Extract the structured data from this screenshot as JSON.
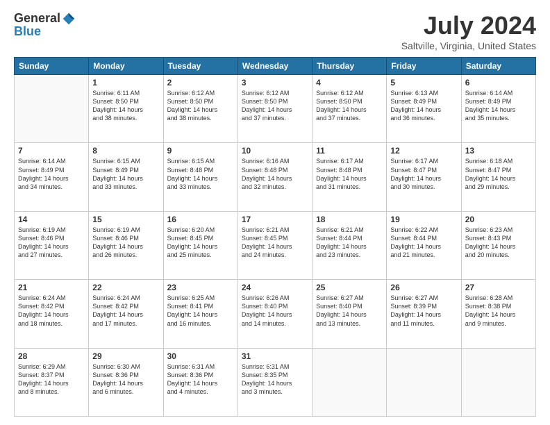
{
  "header": {
    "logo_general": "General",
    "logo_blue": "Blue",
    "month_title": "July 2024",
    "location": "Saltville, Virginia, United States"
  },
  "days_of_week": [
    "Sunday",
    "Monday",
    "Tuesday",
    "Wednesday",
    "Thursday",
    "Friday",
    "Saturday"
  ],
  "weeks": [
    [
      {
        "day": "",
        "info": ""
      },
      {
        "day": "1",
        "info": "Sunrise: 6:11 AM\nSunset: 8:50 PM\nDaylight: 14 hours\nand 38 minutes."
      },
      {
        "day": "2",
        "info": "Sunrise: 6:12 AM\nSunset: 8:50 PM\nDaylight: 14 hours\nand 38 minutes."
      },
      {
        "day": "3",
        "info": "Sunrise: 6:12 AM\nSunset: 8:50 PM\nDaylight: 14 hours\nand 37 minutes."
      },
      {
        "day": "4",
        "info": "Sunrise: 6:12 AM\nSunset: 8:50 PM\nDaylight: 14 hours\nand 37 minutes."
      },
      {
        "day": "5",
        "info": "Sunrise: 6:13 AM\nSunset: 8:49 PM\nDaylight: 14 hours\nand 36 minutes."
      },
      {
        "day": "6",
        "info": "Sunrise: 6:14 AM\nSunset: 8:49 PM\nDaylight: 14 hours\nand 35 minutes."
      }
    ],
    [
      {
        "day": "7",
        "info": "Sunrise: 6:14 AM\nSunset: 8:49 PM\nDaylight: 14 hours\nand 34 minutes."
      },
      {
        "day": "8",
        "info": "Sunrise: 6:15 AM\nSunset: 8:49 PM\nDaylight: 14 hours\nand 33 minutes."
      },
      {
        "day": "9",
        "info": "Sunrise: 6:15 AM\nSunset: 8:48 PM\nDaylight: 14 hours\nand 33 minutes."
      },
      {
        "day": "10",
        "info": "Sunrise: 6:16 AM\nSunset: 8:48 PM\nDaylight: 14 hours\nand 32 minutes."
      },
      {
        "day": "11",
        "info": "Sunrise: 6:17 AM\nSunset: 8:48 PM\nDaylight: 14 hours\nand 31 minutes."
      },
      {
        "day": "12",
        "info": "Sunrise: 6:17 AM\nSunset: 8:47 PM\nDaylight: 14 hours\nand 30 minutes."
      },
      {
        "day": "13",
        "info": "Sunrise: 6:18 AM\nSunset: 8:47 PM\nDaylight: 14 hours\nand 29 minutes."
      }
    ],
    [
      {
        "day": "14",
        "info": "Sunrise: 6:19 AM\nSunset: 8:46 PM\nDaylight: 14 hours\nand 27 minutes."
      },
      {
        "day": "15",
        "info": "Sunrise: 6:19 AM\nSunset: 8:46 PM\nDaylight: 14 hours\nand 26 minutes."
      },
      {
        "day": "16",
        "info": "Sunrise: 6:20 AM\nSunset: 8:45 PM\nDaylight: 14 hours\nand 25 minutes."
      },
      {
        "day": "17",
        "info": "Sunrise: 6:21 AM\nSunset: 8:45 PM\nDaylight: 14 hours\nand 24 minutes."
      },
      {
        "day": "18",
        "info": "Sunrise: 6:21 AM\nSunset: 8:44 PM\nDaylight: 14 hours\nand 23 minutes."
      },
      {
        "day": "19",
        "info": "Sunrise: 6:22 AM\nSunset: 8:44 PM\nDaylight: 14 hours\nand 21 minutes."
      },
      {
        "day": "20",
        "info": "Sunrise: 6:23 AM\nSunset: 8:43 PM\nDaylight: 14 hours\nand 20 minutes."
      }
    ],
    [
      {
        "day": "21",
        "info": "Sunrise: 6:24 AM\nSunset: 8:42 PM\nDaylight: 14 hours\nand 18 minutes."
      },
      {
        "day": "22",
        "info": "Sunrise: 6:24 AM\nSunset: 8:42 PM\nDaylight: 14 hours\nand 17 minutes."
      },
      {
        "day": "23",
        "info": "Sunrise: 6:25 AM\nSunset: 8:41 PM\nDaylight: 14 hours\nand 16 minutes."
      },
      {
        "day": "24",
        "info": "Sunrise: 6:26 AM\nSunset: 8:40 PM\nDaylight: 14 hours\nand 14 minutes."
      },
      {
        "day": "25",
        "info": "Sunrise: 6:27 AM\nSunset: 8:40 PM\nDaylight: 14 hours\nand 13 minutes."
      },
      {
        "day": "26",
        "info": "Sunrise: 6:27 AM\nSunset: 8:39 PM\nDaylight: 14 hours\nand 11 minutes."
      },
      {
        "day": "27",
        "info": "Sunrise: 6:28 AM\nSunset: 8:38 PM\nDaylight: 14 hours\nand 9 minutes."
      }
    ],
    [
      {
        "day": "28",
        "info": "Sunrise: 6:29 AM\nSunset: 8:37 PM\nDaylight: 14 hours\nand 8 minutes."
      },
      {
        "day": "29",
        "info": "Sunrise: 6:30 AM\nSunset: 8:36 PM\nDaylight: 14 hours\nand 6 minutes."
      },
      {
        "day": "30",
        "info": "Sunrise: 6:31 AM\nSunset: 8:36 PM\nDaylight: 14 hours\nand 4 minutes."
      },
      {
        "day": "31",
        "info": "Sunrise: 6:31 AM\nSunset: 8:35 PM\nDaylight: 14 hours\nand 3 minutes."
      },
      {
        "day": "",
        "info": ""
      },
      {
        "day": "",
        "info": ""
      },
      {
        "day": "",
        "info": ""
      }
    ]
  ]
}
